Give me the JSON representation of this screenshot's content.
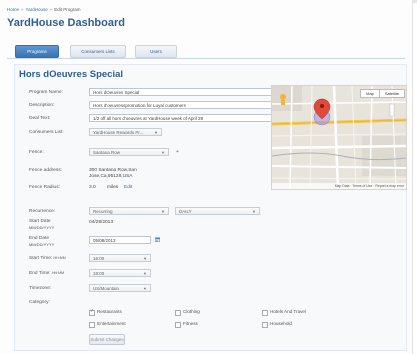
{
  "breadcrumb": {
    "home": "Home",
    "company": "YardHouse",
    "current": "Edit Program"
  },
  "app_title": "YardHouse Dashboard",
  "tabs": [
    {
      "label": "Programs",
      "active": true
    },
    {
      "label": "Consumers Lists",
      "active": false
    },
    {
      "label": "Users",
      "active": false
    }
  ],
  "program_title": "Hors dOeuvres Special",
  "form": {
    "program_name": {
      "label": "Program Name:",
      "value": "Hors dOeuvres Special"
    },
    "description": {
      "label": "Description:",
      "value": "Hors d'oeuvresspromotion for Loyal customers"
    },
    "deal_text": {
      "label": "Deal Text:",
      "value": "1/2 off all hors d'oeuvres at YardHouse week of April 29"
    },
    "consumers_list": {
      "label": "Consumers List:",
      "value": "YardHouse Rewards Pr..."
    },
    "fence": {
      "label": "Fence:",
      "value": "Santana Row"
    },
    "fence_address": {
      "label": "Fence address:",
      "value": "300 Santana Row,San Jose,Ca,95128,USA"
    },
    "fence_radius": {
      "label": "Fence Radius:",
      "value": "3.0",
      "unit": "miles",
      "edit": "Edit"
    },
    "recurrence": {
      "label": "Recurrence:",
      "value": "Recurring",
      "frequency": "DAILY"
    },
    "start_date": {
      "label": "Start Date",
      "format": "MM/DD/YYYY",
      "value": "04/28/2013"
    },
    "end_date": {
      "label": "End Date",
      "format": "MM/DD/YYYY",
      "value": "05/08/2013"
    },
    "start_time": {
      "label": "Start Time:",
      "format": "HH:MM",
      "value": "16:00"
    },
    "end_time": {
      "label": "End Time:",
      "format": "HH:MM",
      "value": "18:00"
    },
    "timezone": {
      "label": "Timezone:",
      "value": "US/Mountain"
    },
    "category": {
      "label": "Category:"
    }
  },
  "categories": [
    {
      "label": "Restaurants",
      "checked": true
    },
    {
      "label": "Clothing",
      "checked": false
    },
    {
      "label": "Hotels And Travel",
      "checked": false
    },
    {
      "label": "Entertainment",
      "checked": false
    },
    {
      "label": "Fitness",
      "checked": false
    },
    {
      "label": "Household",
      "checked": false
    }
  ],
  "map": {
    "btn_map": "Map",
    "btn_satellite": "Satellite",
    "footer": "Map Data · Terms of Use · Report a map error",
    "pin_color": "#e04a3a",
    "fence_color": "#9a8fe0"
  },
  "submit_label": "Submit Changes",
  "colors": {
    "accent": "#2f5e91",
    "tab_active": "#4a84c2",
    "link": "#3a6aa8"
  }
}
